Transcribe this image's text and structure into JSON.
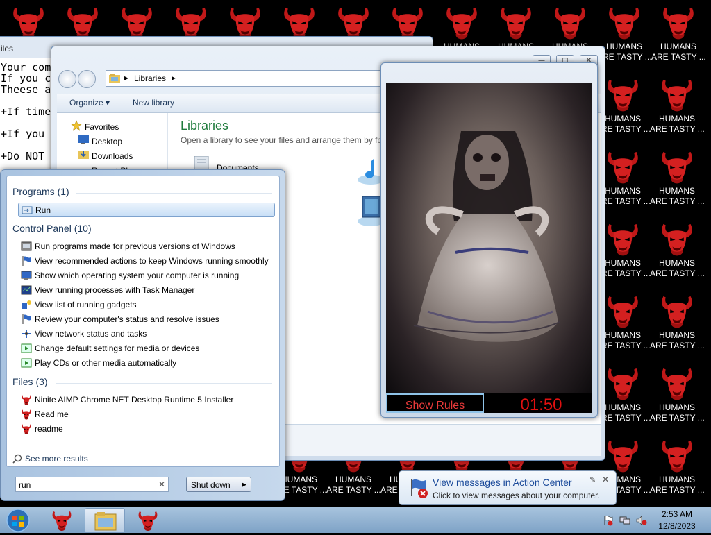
{
  "desktop": {
    "icons": [
      {
        "label": ""
      },
      {
        "label": ""
      },
      {
        "label": ""
      },
      {
        "label": ""
      },
      {
        "label": ""
      },
      {
        "label": ""
      },
      {
        "label": ""
      },
      {
        "label": ""
      },
      {
        "label": ""
      },
      {
        "label": ""
      },
      {
        "label": ""
      },
      {
        "label": ""
      },
      {
        "label": ""
      },
      {
        "label": "HUMANS"
      },
      {
        "label": "HUMANS"
      },
      {
        "label": "HUMANS"
      },
      {
        "label": "HUMANS"
      },
      {
        "label": "HUMANS"
      }
    ],
    "tasty_label_1": "HUMANS",
    "tasty_label_2": "ARE TASTY ...",
    "red_color": "#d42020"
  },
  "notepad": {
    "title": "iles",
    "lines": [
      "Your com",
      "If you c",
      "Theese a",
      "",
      "+If time",
      "",
      "+If you",
      "",
      "+Do NOT"
    ]
  },
  "explorer": {
    "address_root": "Libraries",
    "organize_label": "Organize",
    "new_library_label": "New library",
    "nav": {
      "favorites": "Favorites",
      "desktop": "Desktop",
      "downloads": "Downloads",
      "recent": "Recent Pl"
    },
    "content_title": "Libraries",
    "content_subtitle": "Open a library to see your files and arrange them by fol",
    "documents_label": "Documents"
  },
  "timer_window": {
    "show_rules_label": "Show Rules",
    "countdown": "01:50"
  },
  "start_menu": {
    "programs_header": "Programs (1)",
    "programs": [
      {
        "label": "Run",
        "icon": "run-icon"
      }
    ],
    "control_panel_header": "Control Panel (10)",
    "control_panel": [
      {
        "label": "Run programs made for previous versions of Windows",
        "icon": "compatibility-icon"
      },
      {
        "label": "View recommended actions to keep Windows running smoothly",
        "icon": "flag-icon"
      },
      {
        "label": "Show which operating system your computer is running",
        "icon": "system-icon"
      },
      {
        "label": "View running processes with Task Manager",
        "icon": "task-manager-icon"
      },
      {
        "label": "View list of running gadgets",
        "icon": "gadgets-icon"
      },
      {
        "label": "Review your computer's status and resolve issues",
        "icon": "flag-icon"
      },
      {
        "label": "View network status and tasks",
        "icon": "network-icon"
      },
      {
        "label": "Change default settings for media or devices",
        "icon": "autoplay-icon"
      },
      {
        "label": "Play CDs or other media automatically",
        "icon": "autoplay-icon"
      }
    ],
    "files_header": "Files (3)",
    "files": [
      {
        "label": "Ninite AIMP Chrome NET Desktop Runtime 5 Installer",
        "icon": "demon-icon"
      },
      {
        "label": "Read me",
        "icon": "demon-icon"
      },
      {
        "label": "readme",
        "icon": "demon-icon"
      }
    ],
    "see_more": "See more results",
    "search_value": "run",
    "shutdown_label": "Shut down"
  },
  "toast": {
    "title": "View messages in Action Center",
    "subtitle": "Click to view messages about your computer."
  },
  "taskbar": {
    "time": "2:53 AM",
    "date": "12/8/2023"
  }
}
